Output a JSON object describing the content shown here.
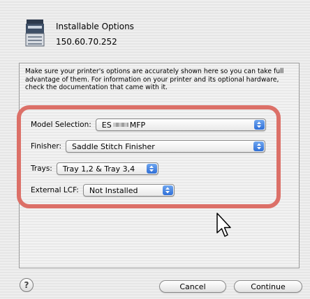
{
  "header": {
    "title": "Installable Options",
    "address": "150.60.70.252",
    "icon": "printer-icon"
  },
  "intro_text": "Make sure your printer's options are accurately shown here so you can take full advantage of them. For information on your printer and its optional hardware, check the documentation that came with it.",
  "options": {
    "model": {
      "label": "Model Selection:",
      "value_prefix": "ES",
      "value_suffix": "MFP"
    },
    "finisher": {
      "label": "Finisher:",
      "value": "Saddle Stitch Finisher"
    },
    "trays": {
      "label": "Trays:",
      "value": "Tray 1,2 & Tray 3,4"
    },
    "external_lcf": {
      "label": "External LCF:",
      "value": "Not Installed"
    }
  },
  "buttons": {
    "help": "?",
    "cancel": "Cancel",
    "continue": "Continue"
  },
  "colors": {
    "highlight": "#dc7068",
    "popup_arrows": "#3a7be0"
  }
}
